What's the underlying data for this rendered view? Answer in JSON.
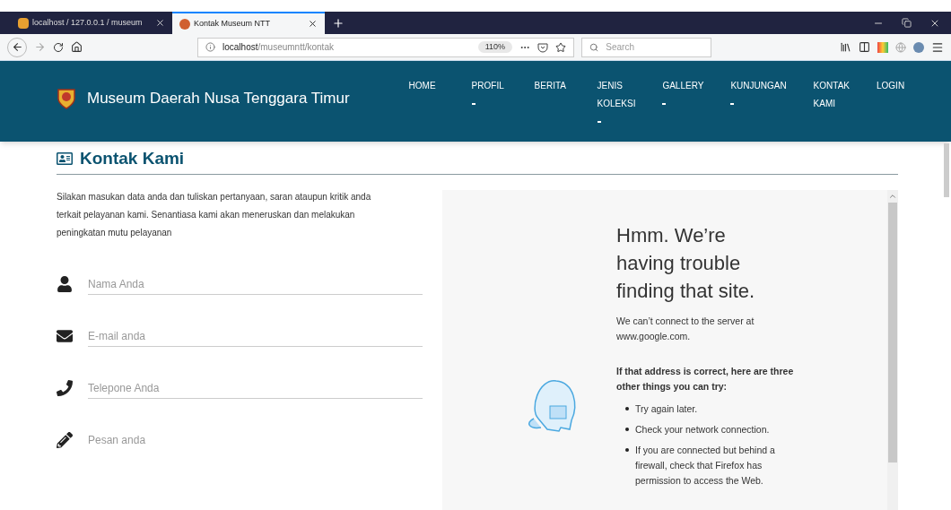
{
  "browser": {
    "tabs": [
      {
        "title": "localhost / 127.0.0.1 / museum",
        "selected": false
      },
      {
        "title": "Kontak Museum NTT",
        "selected": true
      }
    ],
    "url_host": "localhost",
    "url_path": "/museumntt/kontak",
    "zoom": "110%",
    "search": {
      "placeholder": "Search"
    }
  },
  "site": {
    "title": "Museum Daerah Nusa Tenggara Timur",
    "nav": [
      {
        "lines": [
          "HOME"
        ],
        "dropdown": false
      },
      {
        "lines": [
          "PROFIL"
        ],
        "dropdown": true
      },
      {
        "lines": [
          "BERITA"
        ],
        "dropdown": false
      },
      {
        "lines": [
          "JENIS",
          "KOLEKSI"
        ],
        "dropdown": true
      },
      {
        "lines": [
          "GALLERY"
        ],
        "dropdown": true
      },
      {
        "lines": [
          "KUNJUNGAN"
        ],
        "dropdown": true
      },
      {
        "lines": [
          "KONTAK",
          "KAMI"
        ],
        "dropdown": false
      },
      {
        "lines": [
          "LOGIN"
        ],
        "dropdown": false
      }
    ]
  },
  "page": {
    "heading": "Kontak Kami",
    "intro": "Silakan masukan data anda dan tuliskan pertanyaan, saran ataupun kritik anda terkait pelayanan kami. Senantiasa kami akan meneruskan dan melakukan peningkatan mutu pelayanan",
    "fields": [
      {
        "kind": "person",
        "placeholder": "Nama Anda",
        "multiline": false
      },
      {
        "kind": "email",
        "placeholder": "E-mail anda",
        "multiline": false
      },
      {
        "kind": "phone",
        "placeholder": "Telepone Anda",
        "multiline": false
      },
      {
        "kind": "pencil",
        "placeholder": "Pesan anda",
        "multiline": true
      }
    ]
  },
  "map_frame": {
    "title": "Hmm. We’re having trouble finding that site.",
    "message": "We can’t connect to the server at www.google.com.",
    "suggestion_heading": "If that address is correct, here are three other things you can try:",
    "suggestions": [
      "Try again later.",
      "Check your network connection.",
      "If you are connected but behind a firewall, check that Firefox has permission to access the Web."
    ]
  }
}
